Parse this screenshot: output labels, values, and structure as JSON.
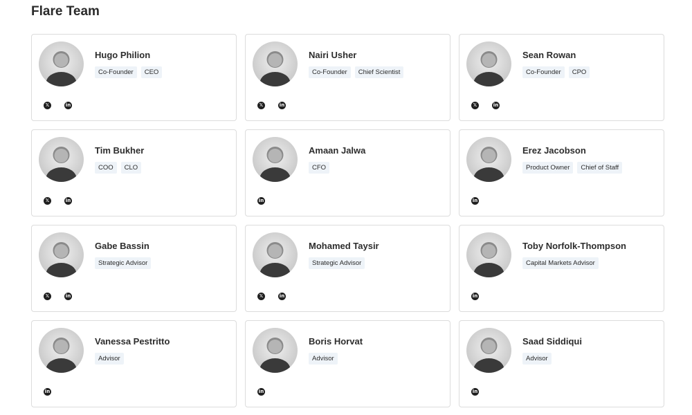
{
  "page": {
    "title": "Flare Team"
  },
  "members": [
    {
      "name": "Hugo Philion",
      "roles": [
        "Co-Founder",
        "CEO"
      ],
      "socials": [
        "x",
        "linkedin"
      ],
      "avatar_icon": "person-photo-icon"
    },
    {
      "name": "Nairi Usher",
      "roles": [
        "Co-Founder",
        "Chief Scientist"
      ],
      "socials": [
        "x",
        "linkedin"
      ],
      "avatar_icon": "person-photo-icon"
    },
    {
      "name": "Sean Rowan",
      "roles": [
        "Co-Founder",
        "CPO"
      ],
      "socials": [
        "x",
        "linkedin"
      ],
      "avatar_icon": "person-photo-icon"
    },
    {
      "name": "Tim Bukher",
      "roles": [
        "COO",
        "CLO"
      ],
      "socials": [
        "x",
        "linkedin"
      ],
      "avatar_icon": "person-photo-icon"
    },
    {
      "name": "Amaan Jalwa",
      "roles": [
        "CFO"
      ],
      "socials": [
        "linkedin"
      ],
      "avatar_icon": "person-photo-icon"
    },
    {
      "name": "Erez Jacobson",
      "roles": [
        "Product Owner",
        "Chief of Staff"
      ],
      "socials": [
        "linkedin"
      ],
      "avatar_icon": "person-photo-icon"
    },
    {
      "name": "Gabe Bassin",
      "roles": [
        "Strategic Advisor"
      ],
      "socials": [
        "x",
        "linkedin"
      ],
      "avatar_icon": "person-photo-icon"
    },
    {
      "name": "Mohamed Taysir",
      "roles": [
        "Strategic Advisor"
      ],
      "socials": [
        "x",
        "linkedin"
      ],
      "avatar_icon": "person-photo-icon"
    },
    {
      "name": "Toby Norfolk-Thompson",
      "roles": [
        "Capital Markets Advisor"
      ],
      "socials": [
        "linkedin"
      ],
      "avatar_icon": "person-photo-icon"
    },
    {
      "name": "Vanessa Pestritto",
      "roles": [
        "Advisor"
      ],
      "socials": [
        "linkedin"
      ],
      "avatar_icon": "person-photo-icon"
    },
    {
      "name": "Boris Horvat",
      "roles": [
        "Advisor"
      ],
      "socials": [
        "linkedin"
      ],
      "avatar_icon": "person-photo-icon"
    },
    {
      "name": "Saad Siddiqui",
      "roles": [
        "Advisor"
      ],
      "socials": [
        "linkedin"
      ],
      "avatar_icon": "person-photo-icon"
    }
  ],
  "social_icons": {
    "x": {
      "glyph": "𝕏",
      "icon": "x-twitter-icon"
    },
    "linkedin": {
      "glyph": "in",
      "icon": "linkedin-icon"
    }
  },
  "colors": {
    "tag_bg": "#eef3f8",
    "card_border": "#dcdcdc",
    "social_icon_bg": "#1f1f1f"
  }
}
